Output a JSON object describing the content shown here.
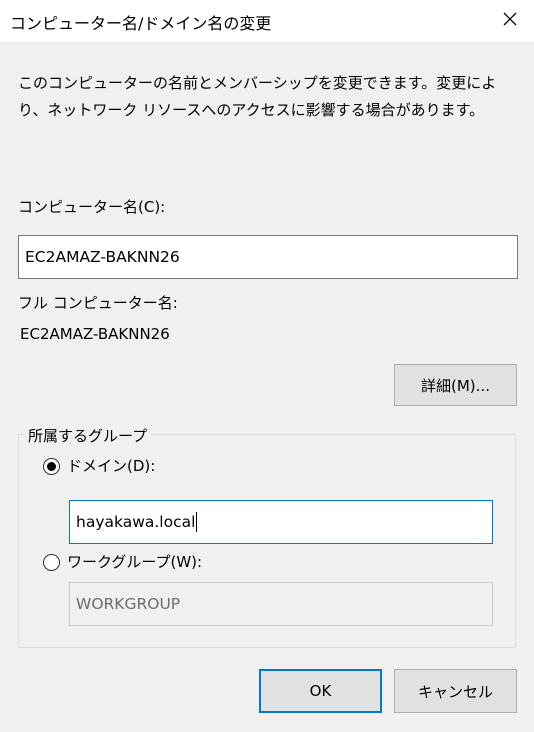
{
  "window": {
    "title": "コンピューター名/ドメイン名の変更"
  },
  "description": "このコンピューターの名前とメンバーシップを変更できます。変更により、ネットワーク リソースへのアクセスに影響する場合があります。",
  "computer_name": {
    "label": "コンピューター名(C):",
    "value": "EC2AMAZ-BAKNN26"
  },
  "full_name": {
    "label": "フル コンピューター名:",
    "value": "EC2AMAZ-BAKNN26"
  },
  "details_button": "詳細(M)...",
  "membership": {
    "legend": "所属するグループ",
    "domain": {
      "label": "ドメイン(D):",
      "selected": true,
      "value": "hayakawa.local"
    },
    "workgroup": {
      "label": "ワークグループ(W):",
      "selected": false,
      "value": "WORKGROUP"
    }
  },
  "buttons": {
    "ok": "OK",
    "cancel": "キャンセル"
  },
  "colors": {
    "accent": "#0078d7",
    "background": "#f0f0f0",
    "disabled_text": "#6d6d6d"
  }
}
